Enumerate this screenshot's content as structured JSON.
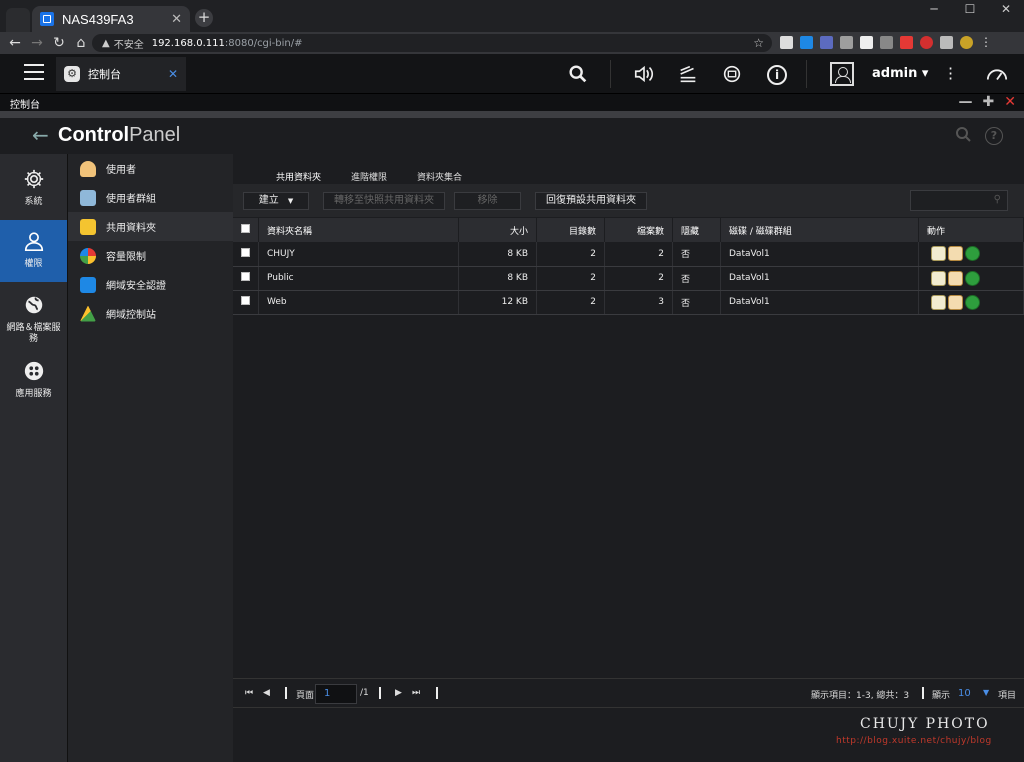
{
  "browser": {
    "tab_title": "NAS439FA3",
    "url_warning": "不安全",
    "url_host": "192.168.0.111",
    "url_path": ":8080/cgi-bin/#"
  },
  "topbar": {
    "app_tab_label": "控制台",
    "username": "admin ▾"
  },
  "window": {
    "title": "控制台"
  },
  "header": {
    "title_bold": "Control",
    "title_light": "Panel"
  },
  "nav": {
    "items": [
      {
        "label": "系統"
      },
      {
        "label": "權限"
      },
      {
        "label": "網路＆檔案服務"
      },
      {
        "label": "應用服務"
      }
    ]
  },
  "subnav": {
    "items": [
      {
        "label": "使用者"
      },
      {
        "label": "使用者群組"
      },
      {
        "label": "共用資料夾"
      },
      {
        "label": "容量限制"
      },
      {
        "label": "網域安全認證"
      },
      {
        "label": "網域控制站"
      }
    ]
  },
  "tabs": [
    "共用資料夾",
    "進階權限",
    "資料夾集合"
  ],
  "toolbar": {
    "create": "建立",
    "snapshot": "轉移至快照共用資料夾",
    "remove": "移除",
    "restore": "回復預設共用資料夾"
  },
  "table": {
    "headers": {
      "name": "資料夾名稱",
      "size": "大小",
      "dirs": "目錄數",
      "files": "檔案數",
      "hidden": "隱藏",
      "volume": "磁碟 / 磁碟群組",
      "action": "動作"
    },
    "rows": [
      {
        "name": "CHUJY",
        "size": "8 KB",
        "dirs": "2",
        "files": "2",
        "hidden": "否",
        "volume": "DataVol1"
      },
      {
        "name": "Public",
        "size": "8 KB",
        "dirs": "2",
        "files": "2",
        "hidden": "否",
        "volume": "DataVol1"
      },
      {
        "name": "Web",
        "size": "12 KB",
        "dirs": "2",
        "files": "3",
        "hidden": "否",
        "volume": "DataVol1"
      }
    ]
  },
  "pager": {
    "page_label": "頁面",
    "page_value": "1",
    "page_total": "/1",
    "summary": "顯示項目：1-3, 總共：3",
    "show_label": "顯示",
    "per_page": "10",
    "items_label": "項目"
  },
  "watermark": {
    "title": "CHUJY PHOTO",
    "url": "http://blog.xuite.net/chujy/blog"
  }
}
